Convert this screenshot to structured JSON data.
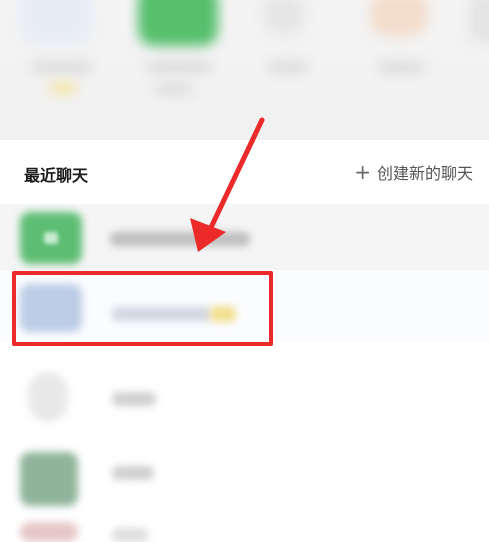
{
  "section": {
    "title": "最近聊天",
    "new_chat_label": "创建新的聊天",
    "new_chat_icon": "plus-icon"
  },
  "annotation": {
    "color": "#ec2a2a",
    "arrow_icon": "arrow-icon"
  }
}
